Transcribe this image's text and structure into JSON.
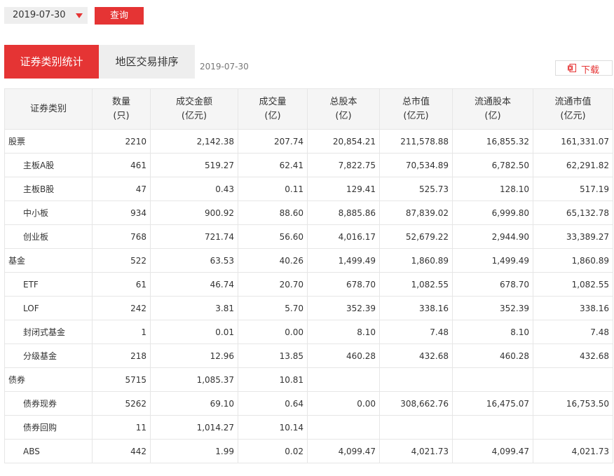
{
  "filter": {
    "date_value": "2019-07-30",
    "query_label": "查询"
  },
  "tabs": [
    {
      "label": "证券类别统计"
    },
    {
      "label": "地区交易排序"
    }
  ],
  "tab_date": "2019-07-30",
  "download_label": "下载",
  "accent_color": "#e53434",
  "table": {
    "headers": [
      {
        "line1": "证券类别",
        "line2": ""
      },
      {
        "line1": "数量",
        "line2": "(只)"
      },
      {
        "line1": "成交金额",
        "line2": "(亿元)"
      },
      {
        "line1": "成交量",
        "line2": "(亿)"
      },
      {
        "line1": "总股本",
        "line2": "(亿)"
      },
      {
        "line1": "总市值",
        "line2": "(亿元)"
      },
      {
        "line1": "流通股本",
        "line2": "(亿)"
      },
      {
        "line1": "流通市值",
        "line2": "(亿元)"
      }
    ],
    "rows": [
      {
        "cells": [
          "股票",
          "2210",
          "2,142.38",
          "207.74",
          "20,854.21",
          "211,578.88",
          "16,855.32",
          "161,331.07"
        ]
      },
      {
        "cells": [
          "主板A股",
          "461",
          "519.27",
          "62.41",
          "7,822.75",
          "70,534.89",
          "6,782.50",
          "62,291.82"
        ]
      },
      {
        "cells": [
          "主板B股",
          "47",
          "0.43",
          "0.11",
          "129.41",
          "525.73",
          "128.10",
          "517.19"
        ]
      },
      {
        "cells": [
          "中小板",
          "934",
          "900.92",
          "88.60",
          "8,885.86",
          "87,839.02",
          "6,999.80",
          "65,132.78"
        ]
      },
      {
        "cells": [
          "创业板",
          "768",
          "721.74",
          "56.60",
          "4,016.17",
          "52,679.22",
          "2,944.90",
          "33,389.27"
        ]
      },
      {
        "cells": [
          "基金",
          "522",
          "63.53",
          "40.26",
          "1,499.49",
          "1,860.89",
          "1,499.49",
          "1,860.89"
        ]
      },
      {
        "cells": [
          "ETF",
          "61",
          "46.74",
          "20.70",
          "678.70",
          "1,082.55",
          "678.70",
          "1,082.55"
        ]
      },
      {
        "cells": [
          "LOF",
          "242",
          "3.81",
          "5.70",
          "352.39",
          "338.16",
          "352.39",
          "338.16"
        ]
      },
      {
        "cells": [
          "封闭式基金",
          "1",
          "0.01",
          "0.00",
          "8.10",
          "7.48",
          "8.10",
          "7.48"
        ]
      },
      {
        "cells": [
          "分级基金",
          "218",
          "12.96",
          "13.85",
          "460.28",
          "432.68",
          "460.28",
          "432.68"
        ]
      },
      {
        "cells": [
          "债券",
          "5715",
          "1,085.37",
          "10.81",
          "",
          "",
          "",
          ""
        ]
      },
      {
        "cells": [
          "债券现券",
          "5262",
          "69.10",
          "0.64",
          "0.00",
          "308,662.76",
          "16,475.07",
          "16,753.50"
        ]
      },
      {
        "cells": [
          "债券回购",
          "11",
          "1,014.27",
          "10.14",
          "",
          "",
          "",
          ""
        ]
      },
      {
        "cells": [
          "ABS",
          "442",
          "1.99",
          "0.02",
          "4,099.47",
          "4,021.73",
          "4,099.47",
          "4,021.73"
        ]
      }
    ]
  }
}
